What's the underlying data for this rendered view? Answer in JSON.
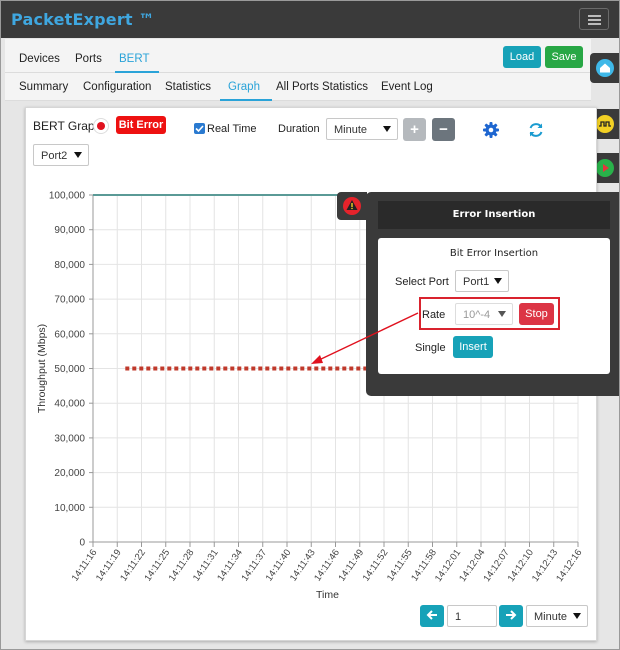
{
  "app": {
    "title": "PacketExpert ™"
  },
  "main_tabs": [
    {
      "label": "Devices"
    },
    {
      "label": "Ports"
    },
    {
      "label": "BERT"
    }
  ],
  "actions": {
    "load_label": "Load",
    "save_label": "Save"
  },
  "sub_tabs": [
    {
      "label": "Summary"
    },
    {
      "label": "Configuration"
    },
    {
      "label": "Statistics"
    },
    {
      "label": "Graph"
    },
    {
      "label": "All Ports Statistics"
    },
    {
      "label": "Event Log"
    }
  ],
  "graph_toolbar": {
    "title": "BERT Graph",
    "bit_error_label": "Bit Error",
    "real_time_label": "Real Time",
    "real_time_checked": true,
    "duration_label": "Duration",
    "duration_value": "Minute",
    "plus_label": "+",
    "minus_label": "−",
    "port_value": "Port2"
  },
  "pager": {
    "page": "1",
    "unit": "Minute"
  },
  "error_insertion": {
    "title": "Error Insertion",
    "subtitle": "Bit Error Insertion",
    "select_port_label": "Select Port",
    "port_value": "Port1",
    "rate_label": "Rate",
    "rate_value": "10^-4",
    "stop_label": "Stop",
    "single_label": "Single",
    "insert_label": "Insert"
  },
  "colors": {
    "accent": "#2aa3d8",
    "load": "#17a2b8",
    "save": "#28a745",
    "danger": "#dc3545",
    "topbar": "#3a3a3a",
    "series_1": "#5a9a96",
    "series_2": "#c0392b"
  },
  "chart_data": {
    "type": "line",
    "xlabel": "Time",
    "ylabel": "Throughput (Mbps)",
    "ylim": [
      0,
      100000
    ],
    "y_ticks": [
      "100,000",
      "90,000",
      "80,000",
      "70,000",
      "60,000",
      "50,000",
      "40,000",
      "30,000",
      "20,000",
      "10,000",
      "0"
    ],
    "x_ticks": [
      "14:11:16",
      "14:11:19",
      "14:11:22",
      "14:11:25",
      "14:11:28",
      "14:11:31",
      "14:11:34",
      "14:11:37",
      "14:11:40",
      "14:11:43",
      "14:11:46",
      "14:11:49",
      "14:11:52",
      "14:11:55",
      "14:11:58",
      "14:12:01",
      "14:12:04",
      "14:12:07",
      "14:12:10",
      "14:12:13",
      "14:12:16"
    ],
    "grid": true,
    "series": [
      {
        "x": [
          "14:11:16",
          "14:12:16"
        ],
        "y": [
          100000,
          100000
        ],
        "color": "#5a9a96",
        "style": "solid"
      },
      {
        "x": [
          "14:11:20",
          "14:12:16"
        ],
        "y": [
          50000,
          50000
        ],
        "color": "#c0392b",
        "style": "dotted"
      }
    ]
  }
}
